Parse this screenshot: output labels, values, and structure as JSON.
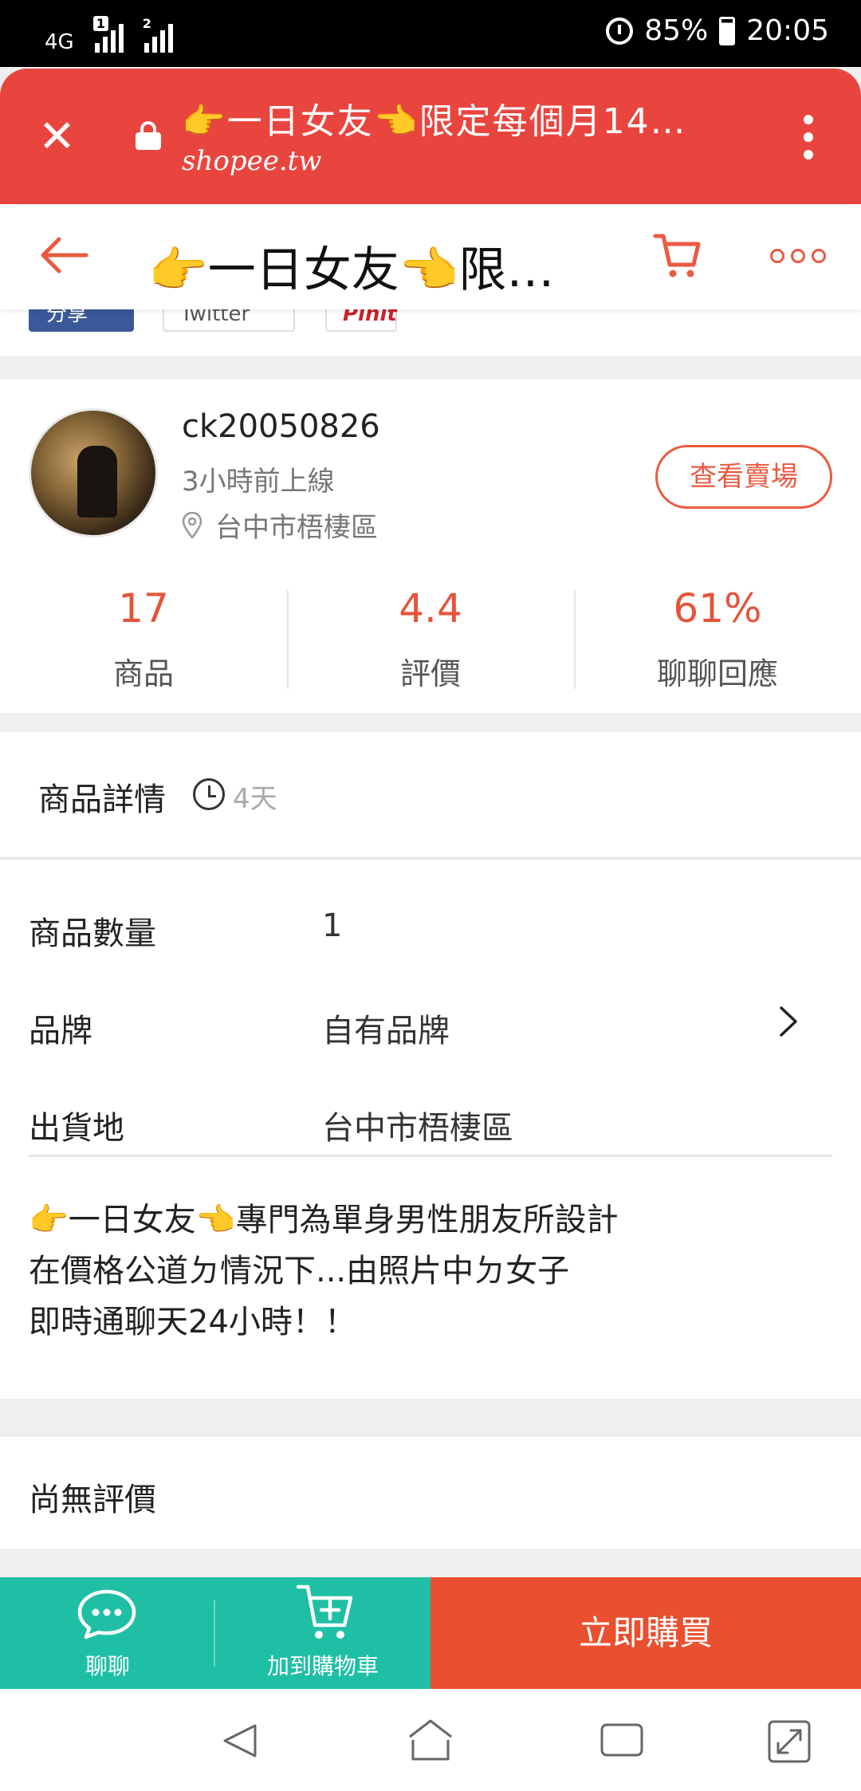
{
  "status_bar": {
    "network": "4G",
    "sim1": "1",
    "sim2": "2",
    "battery": "85%",
    "time": "20:05"
  },
  "browser": {
    "title": "👉一日女友👈限定每個月14…",
    "domain": "shopee.tw",
    "icons": [
      "close-icon",
      "lock-icon",
      "more-vert-icon"
    ]
  },
  "app_header": {
    "title": "👉一日女友👈限定...",
    "icons": [
      "back-arrow-icon",
      "cart-icon",
      "more-horiz-icon"
    ]
  },
  "share": {
    "facebook": "分享",
    "twitter": "Twitter",
    "pinterest": "Pinit"
  },
  "seller": {
    "name": "ck20050826",
    "last_online": "3小時前上線",
    "location": "台中市梧棲區",
    "view_shop": "查看賣場",
    "stats": [
      {
        "value": "17",
        "label": "商品"
      },
      {
        "value": "4.4",
        "label": "評價"
      },
      {
        "value": "61%",
        "label": "聊聊回應"
      }
    ]
  },
  "details": {
    "title": "商品詳情",
    "age": "4天",
    "specs": [
      {
        "key": "商品數量",
        "value": "1"
      },
      {
        "key": "品牌",
        "value": "自有品牌"
      },
      {
        "key": "出貨地",
        "value": "台中市梧棲區"
      }
    ],
    "description": [
      "👉一日女友👈專門為單身男性朋友所設計",
      "在價格公道ㄉ情況下...由照片中ㄉ女子",
      "即時通聊天24小時！！"
    ]
  },
  "reviews": {
    "empty_text": "尚無評價"
  },
  "bottom_bar": {
    "chat": "聊聊",
    "add_to_cart": "加到購物車",
    "buy_now": "立即購買"
  },
  "colors": {
    "browser_bar": "#e9453f",
    "accent": "#ea5a40",
    "teal": "#1fbfa5",
    "buy": "#e9502f"
  }
}
